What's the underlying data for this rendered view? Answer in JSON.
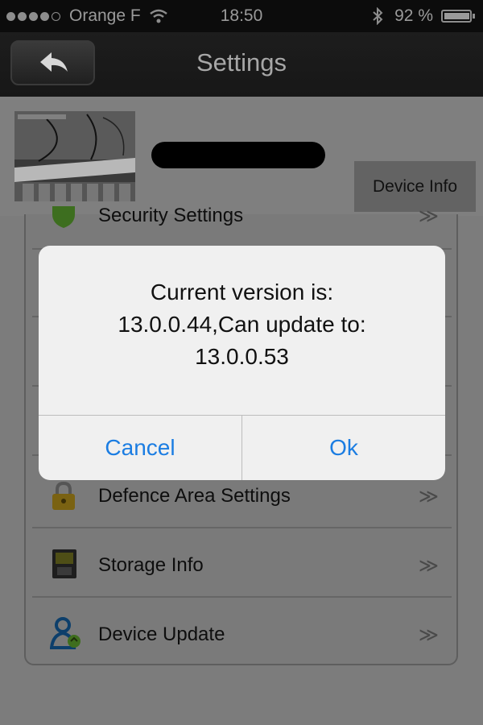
{
  "status_bar": {
    "carrier": "Orange F",
    "time": "18:50",
    "battery_text": "92 %",
    "battery_level": 0.92,
    "signal_bars": 4
  },
  "nav": {
    "title": "Settings",
    "back_icon": "back-arrow-icon"
  },
  "device": {
    "info_button": "Device Info"
  },
  "menu": {
    "items": [
      {
        "label": "Security Settings",
        "icon": "shield-icon"
      },
      {
        "label": "",
        "icon": ""
      },
      {
        "label": "",
        "icon": ""
      },
      {
        "label": "",
        "icon": ""
      },
      {
        "label": "Defence Area Settings",
        "icon": "lock-icon"
      },
      {
        "label": "Storage Info",
        "icon": "sd-card-icon"
      },
      {
        "label": "Device Update",
        "icon": "user-update-icon"
      }
    ],
    "chevron": "≫"
  },
  "dialog": {
    "line1": "Current version is:",
    "line2": "13.0.0.44,Can update to:",
    "line3": "13.0.0.53",
    "cancel": "Cancel",
    "ok": "Ok"
  },
  "colors": {
    "accent": "#1b7de2",
    "navbar": "#1a1a1a",
    "overlay": "#7c7c7c"
  }
}
